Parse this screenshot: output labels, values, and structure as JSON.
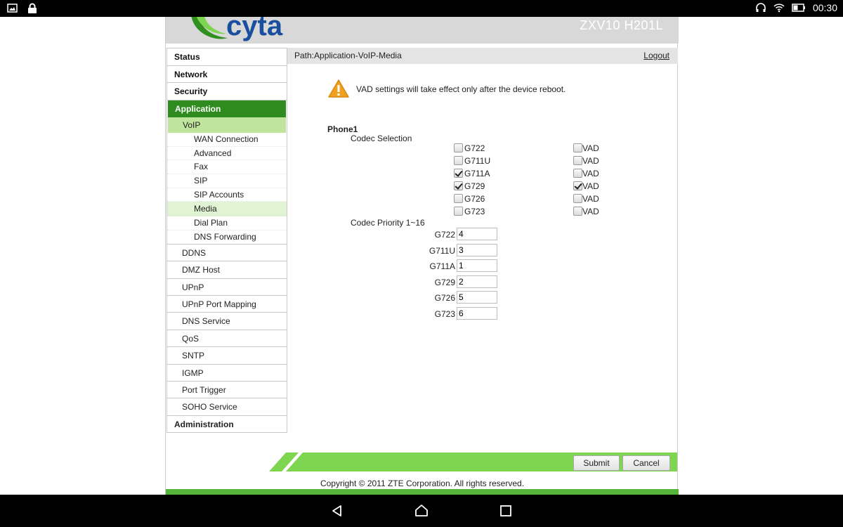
{
  "statusbar": {
    "left_icons": [
      "image-icon",
      "lock-icon"
    ],
    "right_icons": [
      "headphones-icon",
      "wifi-icon",
      "battery-icon"
    ],
    "time": "00:30"
  },
  "header": {
    "brand": "cyta",
    "model": "ZXV10 H201L"
  },
  "sidebar": {
    "top": [
      "Status",
      "Network",
      "Security",
      "Application"
    ],
    "voip": "VoIP",
    "voip_sub": [
      "WAN Connection",
      "Advanced",
      "Fax",
      "SIP",
      "SIP Accounts",
      "Media",
      "Dial Plan",
      "DNS Forwarding"
    ],
    "app_items": [
      "DDNS",
      "DMZ Host",
      "UPnP",
      "UPnP Port Mapping",
      "DNS Service",
      "QoS",
      "SNTP",
      "IGMP",
      "Port Trigger",
      "SOHO Service"
    ],
    "admin": "Administration"
  },
  "content": {
    "path": "Path:Application-VoIP-Media",
    "logout": "Logout",
    "warning": "VAD settings will take effect only after the device reboot.",
    "phone_title": "Phone1",
    "codec_selection_label": "Codec Selection",
    "codecs": [
      {
        "name": "G722",
        "checked": false,
        "vad_label": "VAD",
        "vad": false
      },
      {
        "name": "G711U",
        "checked": false,
        "vad_label": "VAD",
        "vad": false
      },
      {
        "name": "G711A",
        "checked": true,
        "vad_label": "VAD",
        "vad": false
      },
      {
        "name": "G729",
        "checked": true,
        "vad_label": "VAD",
        "vad": true
      },
      {
        "name": "G726",
        "checked": false,
        "vad_label": "VAD",
        "vad": false
      },
      {
        "name": "G723",
        "checked": false,
        "vad_label": "VAD",
        "vad": false
      }
    ],
    "priority_label": "Codec Priority 1~16",
    "priorities": [
      {
        "name": "G722",
        "value": "4"
      },
      {
        "name": "G711U",
        "value": "3"
      },
      {
        "name": "G711A",
        "value": "1"
      },
      {
        "name": "G729",
        "value": "2"
      },
      {
        "name": "G726",
        "value": "5"
      },
      {
        "name": "G723",
        "value": "6"
      }
    ]
  },
  "footer": {
    "submit": "Submit",
    "cancel": "Cancel",
    "copyright": "Copyright © 2011 ZTE Corporation. All rights reserved."
  },
  "colors": {
    "accent_green": "#2e8b1e",
    "light_green": "#bfe59d",
    "bar_green": "#7ed54f"
  }
}
